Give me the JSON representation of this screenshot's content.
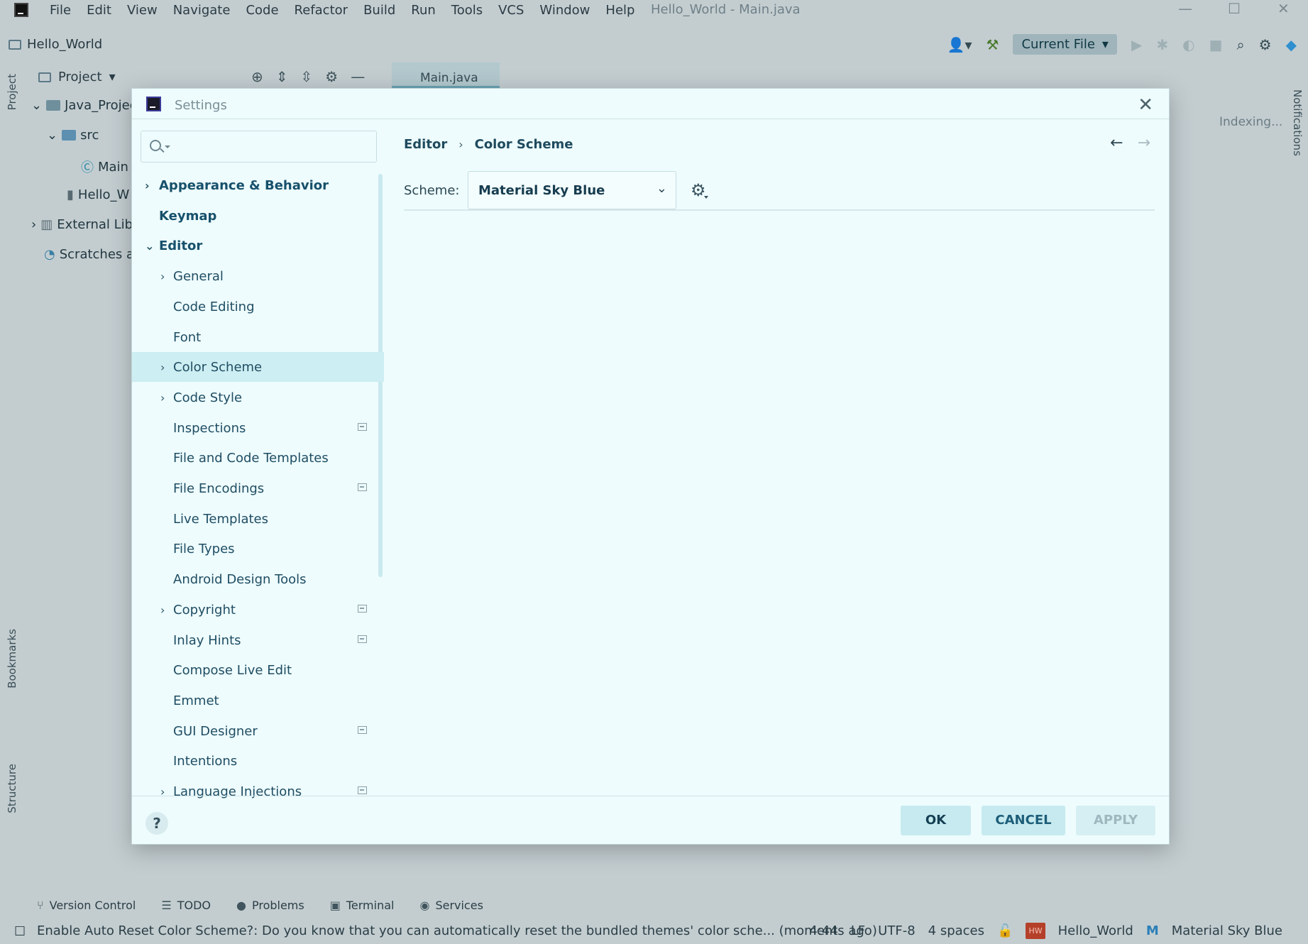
{
  "ide": {
    "menu": [
      "File",
      "Edit",
      "View",
      "Navigate",
      "Code",
      "Refactor",
      "Build",
      "Run",
      "Tools",
      "VCS",
      "Window",
      "Help"
    ],
    "window_title": "Hello_World - Main.java",
    "project_name": "Hello_World",
    "run_config": "Current File",
    "left_strip": {
      "project": "Project",
      "bookmarks": "Bookmarks",
      "structure": "Structure"
    },
    "right_strip": {
      "notifications": "Notifications"
    },
    "project_panel": {
      "header": "Project",
      "tree": [
        "Java_Projec",
        "src",
        "Main",
        "Hello_W",
        "External Lib",
        "Scratches a"
      ]
    },
    "editor_tab": "Main.java",
    "indexing": "Indexing...",
    "bottom_tools": [
      "Version Control",
      "TODO",
      "Problems",
      "Terminal",
      "Services"
    ],
    "status": {
      "message": "Enable Auto Reset Color Scheme?: Do you know that you can automatically reset the bundled themes' color sche... (moments ago)",
      "position": "4:44",
      "line_sep": "LF",
      "encoding": "UTF-8",
      "indent": "4 spaces",
      "badge": "HW",
      "project": "Hello_World",
      "theme": "Material Sky Blue"
    }
  },
  "settings": {
    "title": "Settings",
    "search": {
      "value": "",
      "placeholder": ""
    },
    "nav": [
      {
        "label": "Appearance & Behavior",
        "level": 0,
        "chevron": "›",
        "bold": true,
        "badge": false,
        "selected": false
      },
      {
        "label": "Keymap",
        "level": 0,
        "chevron": "",
        "bold": true,
        "badge": false,
        "selected": false
      },
      {
        "label": "Editor",
        "level": 0,
        "chevron": "⌄",
        "bold": true,
        "badge": false,
        "selected": false
      },
      {
        "label": "General",
        "level": 1,
        "chevron": "›",
        "bold": false,
        "badge": false,
        "selected": false
      },
      {
        "label": "Code Editing",
        "level": 1,
        "chevron": "",
        "bold": false,
        "badge": false,
        "selected": false
      },
      {
        "label": "Font",
        "level": 1,
        "chevron": "",
        "bold": false,
        "badge": false,
        "selected": false
      },
      {
        "label": "Color Scheme",
        "level": 1,
        "chevron": "›",
        "bold": false,
        "badge": false,
        "selected": true
      },
      {
        "label": "Code Style",
        "level": 1,
        "chevron": "›",
        "bold": false,
        "badge": false,
        "selected": false
      },
      {
        "label": "Inspections",
        "level": 1,
        "chevron": "",
        "bold": false,
        "badge": true,
        "selected": false
      },
      {
        "label": "File and Code Templates",
        "level": 1,
        "chevron": "",
        "bold": false,
        "badge": false,
        "selected": false
      },
      {
        "label": "File Encodings",
        "level": 1,
        "chevron": "",
        "bold": false,
        "badge": true,
        "selected": false
      },
      {
        "label": "Live Templates",
        "level": 1,
        "chevron": "",
        "bold": false,
        "badge": false,
        "selected": false
      },
      {
        "label": "File Types",
        "level": 1,
        "chevron": "",
        "bold": false,
        "badge": false,
        "selected": false
      },
      {
        "label": "Android Design Tools",
        "level": 1,
        "chevron": "",
        "bold": false,
        "badge": false,
        "selected": false
      },
      {
        "label": "Copyright",
        "level": 1,
        "chevron": "›",
        "bold": false,
        "badge": true,
        "selected": false
      },
      {
        "label": "Inlay Hints",
        "level": 1,
        "chevron": "",
        "bold": false,
        "badge": true,
        "selected": false
      },
      {
        "label": "Compose Live Edit",
        "level": 1,
        "chevron": "",
        "bold": false,
        "badge": false,
        "selected": false
      },
      {
        "label": "Emmet",
        "level": 1,
        "chevron": "",
        "bold": false,
        "badge": false,
        "selected": false
      },
      {
        "label": "GUI Designer",
        "level": 1,
        "chevron": "",
        "bold": false,
        "badge": true,
        "selected": false
      },
      {
        "label": "Intentions",
        "level": 1,
        "chevron": "",
        "bold": false,
        "badge": false,
        "selected": false
      },
      {
        "label": "Language Injections",
        "level": 1,
        "chevron": "›",
        "bold": false,
        "badge": true,
        "selected": false
      }
    ],
    "breadcrumb": [
      "Editor",
      "Color Scheme"
    ],
    "scheme_label": "Scheme:",
    "scheme_value": "Material Sky Blue",
    "buttons": {
      "ok": "OK",
      "cancel": "CANCEL",
      "apply": "APPLY",
      "help": "?"
    },
    "colors": {
      "accent": "#17506b",
      "selected_row": "#cdeef2",
      "dialog_bg": "#eefcfd"
    }
  }
}
